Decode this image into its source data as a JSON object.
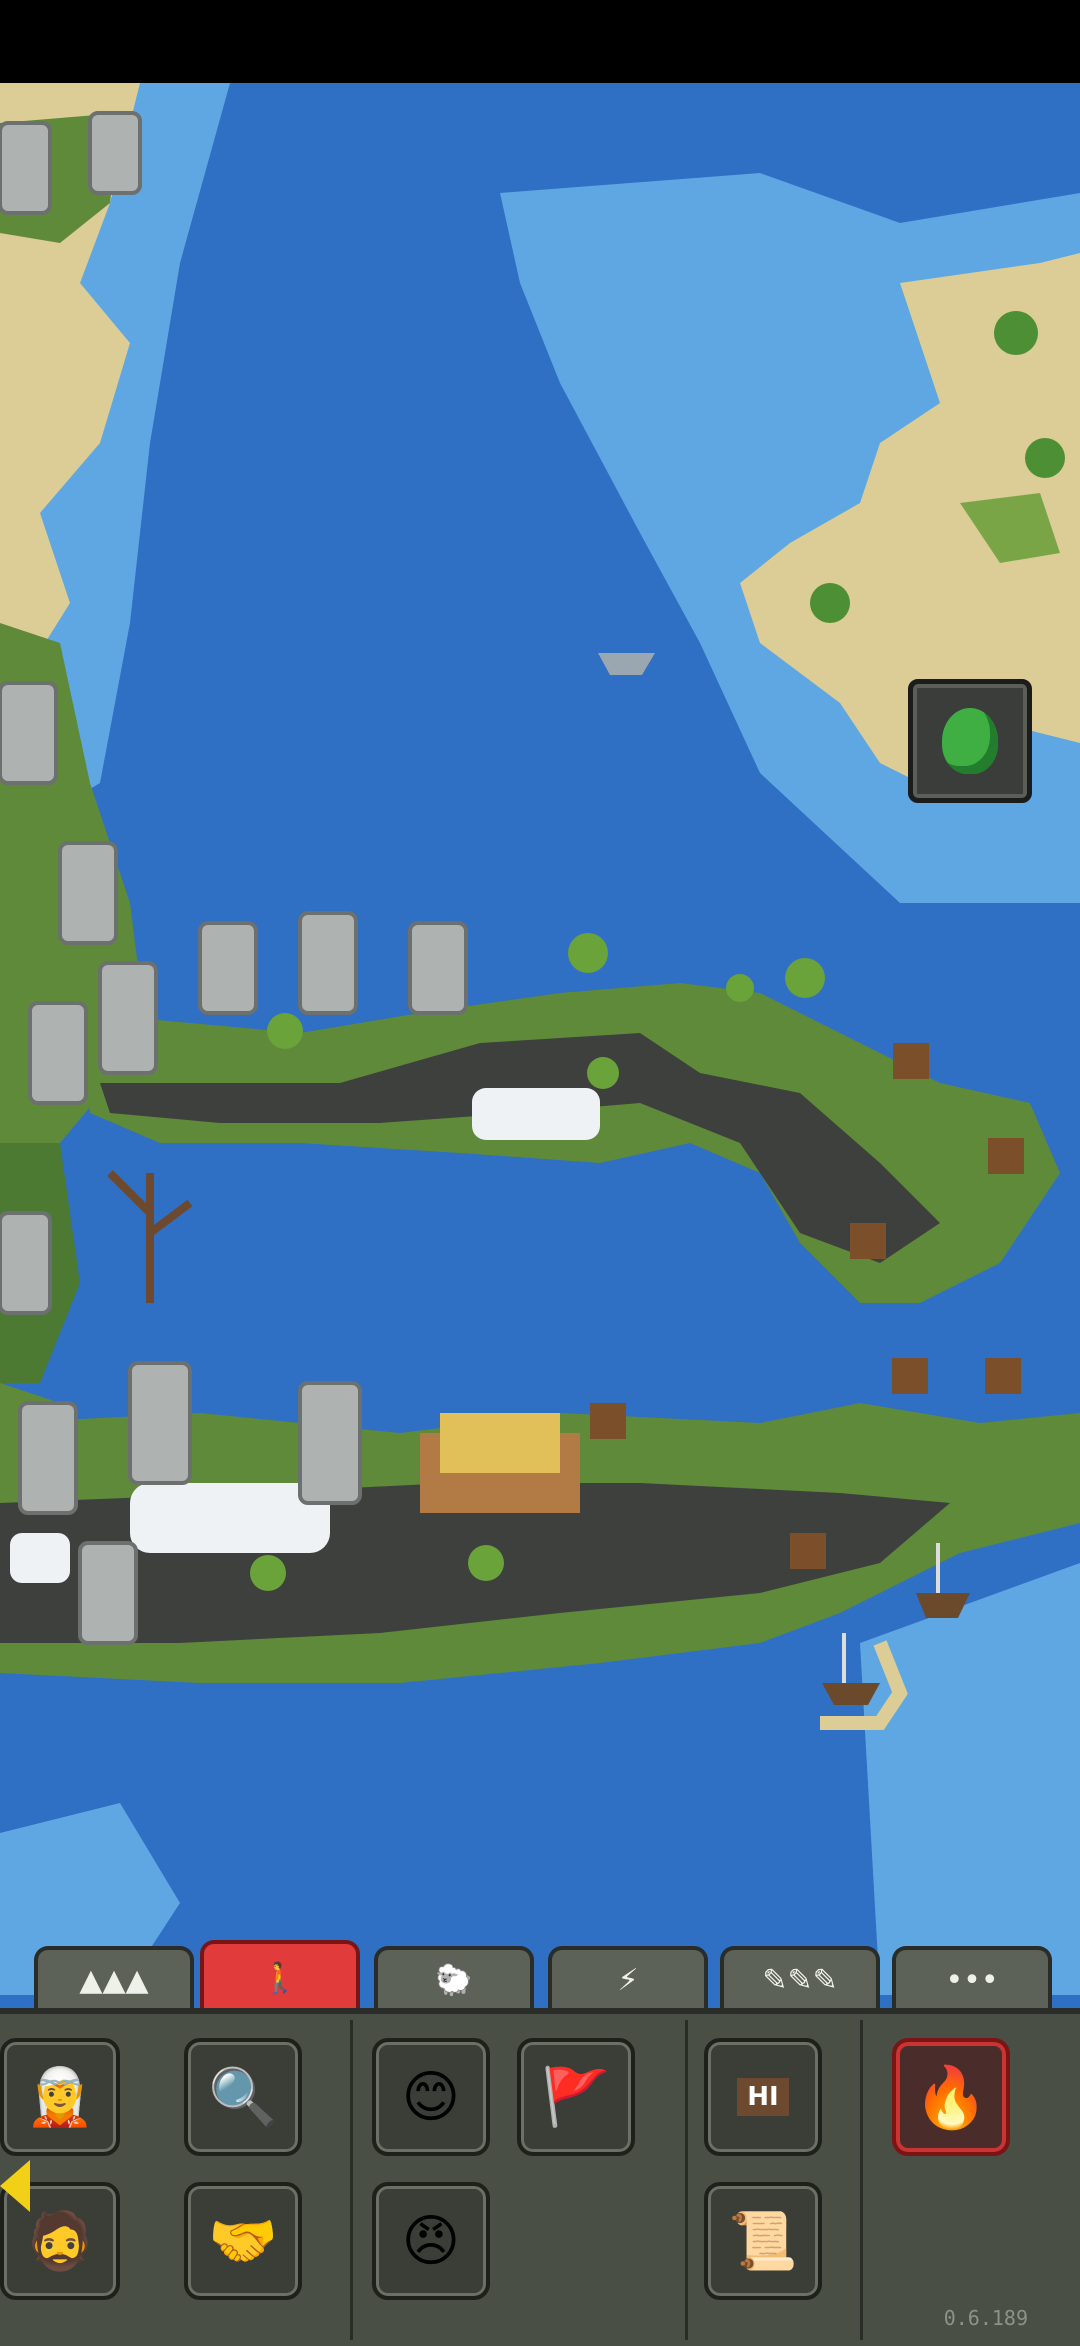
{
  "status_bar": {},
  "map": {
    "power_button": {
      "icon": "green-beetle-icon"
    }
  },
  "toolbar": {
    "tabs": [
      {
        "id": "terrain",
        "icon": "mountains-icon",
        "glyph": "▲▲▲"
      },
      {
        "id": "creatures",
        "icon": "human-icon",
        "glyph": "🚶",
        "active": true
      },
      {
        "id": "animals",
        "icon": "sheep-icon",
        "glyph": "🐑"
      },
      {
        "id": "destruction",
        "icon": "lightning-icon",
        "glyph": "⚡"
      },
      {
        "id": "tools",
        "icon": "brushes-icon",
        "glyph": "✎✎✎"
      },
      {
        "id": "more",
        "icon": "ellipsis-icon",
        "glyph": "•••"
      }
    ]
  },
  "powers": {
    "row1": [
      {
        "icon": "elf-icon",
        "glyph": "🧝"
      },
      {
        "icon": "inspect-village-icon",
        "glyph": "🔍"
      },
      {
        "icon": "friendship-icon",
        "glyph": "😊"
      },
      {
        "icon": "war-flag-icon",
        "glyph": "🚩"
      },
      {
        "icon": "signpost-icon",
        "glyph": "HI"
      },
      {
        "icon": "fire-spirits-icon",
        "glyph": "🔥"
      }
    ],
    "row2": [
      {
        "icon": "dwarf-icon",
        "glyph": "🧔"
      },
      {
        "icon": "alliance-handshake-icon",
        "glyph": "🤝"
      },
      {
        "icon": "spite-icon",
        "glyph": "😠"
      },
      {
        "icon": "world-map-scroll-icon",
        "glyph": "📜"
      }
    ]
  },
  "version": "0.6.189"
}
